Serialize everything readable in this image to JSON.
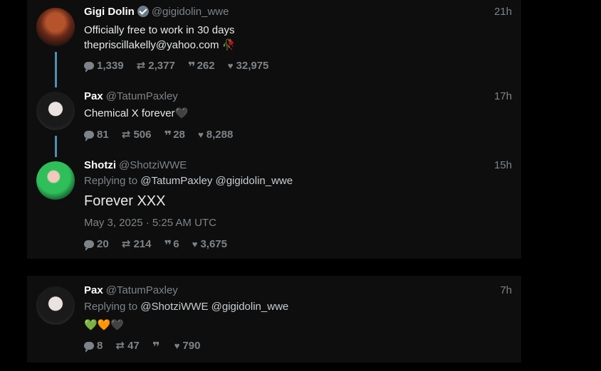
{
  "tweets": [
    {
      "name": "Gigi Dolin",
      "verified": true,
      "handle": "@gigidolin_wwe",
      "time": "21h",
      "line1": "Officially free to work in 30 days",
      "line2": "thepriscillakelly@yahoo.com",
      "emoji": "🥀",
      "stats": {
        "comments": "1,339",
        "retweets": "2,377",
        "quotes": "262",
        "likes": "32,975"
      }
    },
    {
      "name": "Pax",
      "handle": "@TatumPaxley",
      "time": "17h",
      "text": "Chemical X forever🖤",
      "stats": {
        "comments": "81",
        "retweets": "506",
        "quotes": "28",
        "likes": "8,288"
      }
    },
    {
      "name": "Shotzi",
      "handle": "@ShotziWWE",
      "time": "15h",
      "replying_to": "Replying to",
      "mentions": "@TatumPaxley @gigidolin_wwe",
      "text": "Forever XXX",
      "date": "May 3, 2025 · 5:25 AM UTC",
      "stats": {
        "comments": "20",
        "retweets": "214",
        "quotes": "6",
        "likes": "3,675"
      }
    },
    {
      "name": "Pax",
      "handle": "@TatumPaxley",
      "time": "7h",
      "replying_to": "Replying to",
      "mentions": "@ShotziWWE @gigidolin_wwe",
      "text": "💚🧡🖤",
      "stats": {
        "comments": "8",
        "retweets": "47",
        "quotes": "",
        "likes": "790"
      }
    }
  ],
  "icons": {
    "comment": "comment-icon",
    "retweet": "retweet-icon",
    "quote": "quote-icon",
    "like": "heart-icon",
    "verified": "verified-badge-icon"
  },
  "colors": {
    "background": "#000000",
    "panel": "#0e0e0e",
    "muted": "#7d8388",
    "thread_line": "#4f8fb0"
  }
}
